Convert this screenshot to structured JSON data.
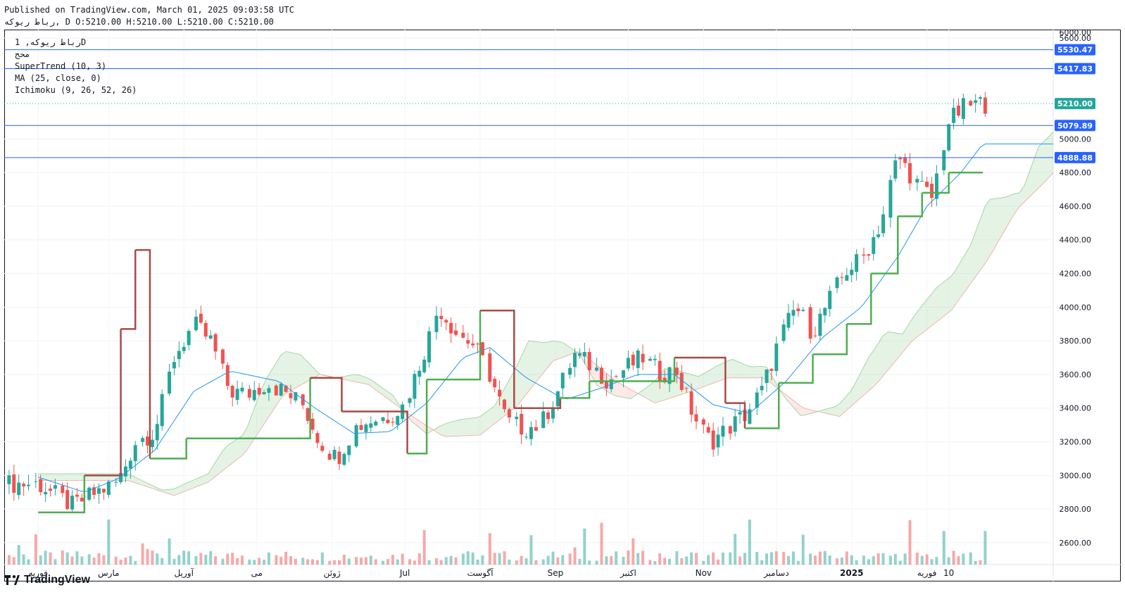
{
  "header": {
    "published": "Published on TradingView.com, March 01, 2025 09:03:58 UTC",
    "ohlc": "رباط ريوكه, D O:5210.00 H:5210.00 L:5210.00 C:5210.00"
  },
  "legend": {
    "symbol": "رباط ريوكه, 1D",
    "sub": "محج",
    "supertrend": "SuperTrend (10, 3)",
    "ma": "MA (25, close, 0)",
    "ichimoku": "Ichimoku (9, 26, 52, 26)"
  },
  "brand": {
    "name": "TradingView"
  },
  "colors": {
    "up": "#26a69a",
    "down": "#ef5350",
    "st_up": "#4caf50",
    "st_down": "#a84a47",
    "ma": "#2196f3",
    "hline": "#2962ff",
    "cloud_up": "#a5d6a7",
    "cloud_down": "#f7b6b3"
  },
  "chart_data": {
    "type": "candlestick",
    "y_range": [
      2470,
      5650
    ],
    "y_ticks": [
      "6000.00",
      "5600.00",
      "5000.00",
      "4800.00",
      "4600.00",
      "4400.00",
      "4200.00",
      "4000.00",
      "3800.00",
      "3600.00",
      "3400.00",
      "3200.00",
      "3000.00",
      "2800.00",
      "2600.00"
    ],
    "x_labels": [
      "فوریه",
      "مارس",
      "آوریل",
      "می",
      "ژوئن",
      "Jul",
      "آگوست",
      "Sep",
      "اکتبر",
      "Nov",
      "دسامبر",
      "2025",
      "فوریه",
      "10"
    ],
    "x_label_dates": [
      "2024-02",
      "2024-03",
      "2024-04",
      "2024-05",
      "2024-06",
      "2024-07",
      "2024-08",
      "2024-09",
      "2024-10",
      "2024-11",
      "2024-12",
      "2025-01",
      "2025-02",
      "2025-02-10"
    ],
    "price_lines": [
      {
        "value": 5530.47,
        "label": "5530.47"
      },
      {
        "value": 5417.83,
        "label": "5417.83"
      },
      {
        "value": 5079.89,
        "label": "5079.89"
      },
      {
        "value": 4888.88,
        "label": "4888.88"
      }
    ],
    "last_price": {
      "value": 5210.0,
      "label": "5210.00"
    },
    "closes_points": [
      [
        "2024-02-01",
        2950
      ],
      [
        "2024-02-15",
        2820
      ],
      [
        "2024-02-25",
        2900
      ],
      [
        "2024-03-05",
        2960
      ],
      [
        "2024-03-12",
        3200
      ],
      [
        "2024-03-20",
        3260
      ],
      [
        "2024-03-28",
        3700
      ],
      [
        "2024-04-05",
        3900
      ],
      [
        "2024-04-12",
        3800
      ],
      [
        "2024-04-20",
        3500
      ],
      [
        "2024-04-27",
        3480
      ],
      [
        "2024-05-05",
        3550
      ],
      [
        "2024-05-12",
        3500
      ],
      [
        "2024-05-20",
        3420
      ],
      [
        "2024-05-27",
        3200
      ],
      [
        "2024-06-03",
        3100
      ],
      [
        "2024-06-10",
        3280
      ],
      [
        "2024-06-17",
        3330
      ],
      [
        "2024-06-24",
        3350
      ],
      [
        "2024-07-01",
        3420
      ],
      [
        "2024-07-08",
        3700
      ],
      [
        "2024-07-15",
        4000
      ],
      [
        "2024-07-22",
        3850
      ],
      [
        "2024-07-29",
        3780
      ],
      [
        "2024-08-05",
        3600
      ],
      [
        "2024-08-12",
        3320
      ],
      [
        "2024-08-19",
        3280
      ],
      [
        "2024-08-26",
        3300
      ],
      [
        "2024-09-02",
        3500
      ],
      [
        "2024-09-09",
        3720
      ],
      [
        "2024-09-16",
        3650
      ],
      [
        "2024-09-23",
        3560
      ],
      [
        "2024-09-30",
        3640
      ],
      [
        "2024-10-07",
        3700
      ],
      [
        "2024-10-14",
        3610
      ],
      [
        "2024-10-21",
        3620
      ],
      [
        "2024-10-28",
        3350
      ],
      [
        "2024-11-04",
        3200
      ],
      [
        "2024-11-11",
        3280
      ],
      [
        "2024-11-18",
        3360
      ],
      [
        "2024-11-25",
        3500
      ],
      [
        "2024-12-02",
        3800
      ],
      [
        "2024-12-09",
        4000
      ],
      [
        "2024-12-16",
        3850
      ],
      [
        "2024-12-23",
        4050
      ],
      [
        "2024-12-30",
        4220
      ],
      [
        "2025-01-06",
        4300
      ],
      [
        "2025-01-13",
        4500
      ],
      [
        "2025-01-20",
        4900
      ],
      [
        "2025-01-27",
        4750
      ],
      [
        "2025-02-03",
        4650
      ],
      [
        "2025-02-10",
        5100
      ],
      [
        "2025-02-17",
        5200
      ],
      [
        "2025-02-24",
        5210
      ]
    ],
    "supertrend_steps": [
      [
        "2024-02-01",
        2780
      ],
      [
        "2024-02-20",
        3000
      ],
      [
        "2024-03-06",
        3870
      ],
      [
        "2024-03-12",
        4340
      ],
      [
        "2024-03-18",
        3100
      ],
      [
        "2024-04-02",
        3220
      ],
      [
        "2024-05-20",
        3220
      ],
      [
        "2024-05-23",
        3580
      ],
      [
        "2024-06-05",
        3380
      ],
      [
        "2024-07-02",
        3130
      ],
      [
        "2024-07-10",
        3570
      ],
      [
        "2024-07-28",
        3570
      ],
      [
        "2024-08-01",
        3980
      ],
      [
        "2024-08-15",
        3400
      ],
      [
        "2024-09-03",
        3460
      ],
      [
        "2024-09-15",
        3560
      ],
      [
        "2024-10-20",
        3700
      ],
      [
        "2024-11-10",
        3430
      ],
      [
        "2024-11-18",
        3280
      ],
      [
        "2024-12-02",
        3550
      ],
      [
        "2024-12-16",
        3720
      ],
      [
        "2024-12-30",
        3900
      ],
      [
        "2025-01-09",
        4200
      ],
      [
        "2025-01-20",
        4540
      ],
      [
        "2025-01-30",
        4680
      ],
      [
        "2025-02-10",
        4800
      ],
      [
        "2025-02-24",
        4800
      ]
    ],
    "ma_points": [
      [
        "2024-02-01",
        2990
      ],
      [
        "2024-02-20",
        2900
      ],
      [
        "2024-03-05",
        2980
      ],
      [
        "2024-03-20",
        3150
      ],
      [
        "2024-04-05",
        3500
      ],
      [
        "2024-04-20",
        3620
      ],
      [
        "2024-05-10",
        3560
      ],
      [
        "2024-05-25",
        3400
      ],
      [
        "2024-06-10",
        3250
      ],
      [
        "2024-06-25",
        3260
      ],
      [
        "2024-07-10",
        3430
      ],
      [
        "2024-07-25",
        3700
      ],
      [
        "2024-08-05",
        3760
      ],
      [
        "2024-08-20",
        3580
      ],
      [
        "2024-09-05",
        3450
      ],
      [
        "2024-09-20",
        3520
      ],
      [
        "2024-10-05",
        3600
      ],
      [
        "2024-10-20",
        3600
      ],
      [
        "2024-11-05",
        3420
      ],
      [
        "2024-11-20",
        3370
      ],
      [
        "2024-12-05",
        3560
      ],
      [
        "2024-12-20",
        3820
      ],
      [
        "2025-01-05",
        4000
      ],
      [
        "2025-01-20",
        4300
      ],
      [
        "2025-02-01",
        4600
      ],
      [
        "2025-02-15",
        4800
      ],
      [
        "2025-02-24",
        4970
      ]
    ],
    "volume_range": [
      0,
      3300
    ]
  }
}
